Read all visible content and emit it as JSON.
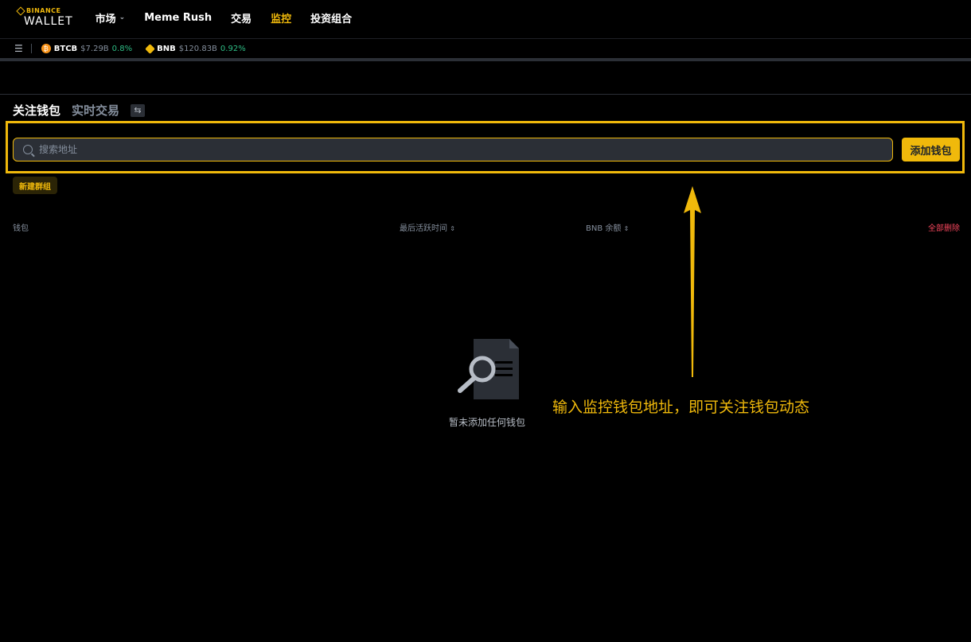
{
  "header": {
    "logo_top": "BINANCE",
    "logo_bottom": "WALLET",
    "nav": [
      {
        "label": "市场",
        "has_dropdown": true,
        "active": false
      },
      {
        "label": "Meme Rush",
        "active": false
      },
      {
        "label": "交易",
        "active": false
      },
      {
        "label": "监控",
        "active": true
      },
      {
        "label": "投资组合",
        "active": false
      }
    ]
  },
  "ticker": {
    "items": [
      {
        "name": "BTCB",
        "price": "$7.29B",
        "change": "0.8%"
      },
      {
        "name": "BNB",
        "price": "$120.83B",
        "change": "0.92%"
      }
    ]
  },
  "tabs": [
    {
      "label": "关注钱包",
      "active": true
    },
    {
      "label": "实时交易",
      "active": false
    }
  ],
  "search": {
    "placeholder": "搜索地址",
    "value": ""
  },
  "add_wallet_label": "添加钱包",
  "new_group_label": "新建群组",
  "table": {
    "col_wallet": "钱包",
    "col_last_active": "最后活跃时间",
    "col_bnb_balance": "BNB 余额",
    "delete_all": "全部删除"
  },
  "empty_state": {
    "text": "暂未添加任何钱包"
  },
  "annotation": {
    "text": "输入监控钱包地址，即可关注钱包动态"
  },
  "colors": {
    "accent": "#f0b90b",
    "positive": "#2ebd85",
    "danger": "#f6465d",
    "background": "#000000"
  }
}
